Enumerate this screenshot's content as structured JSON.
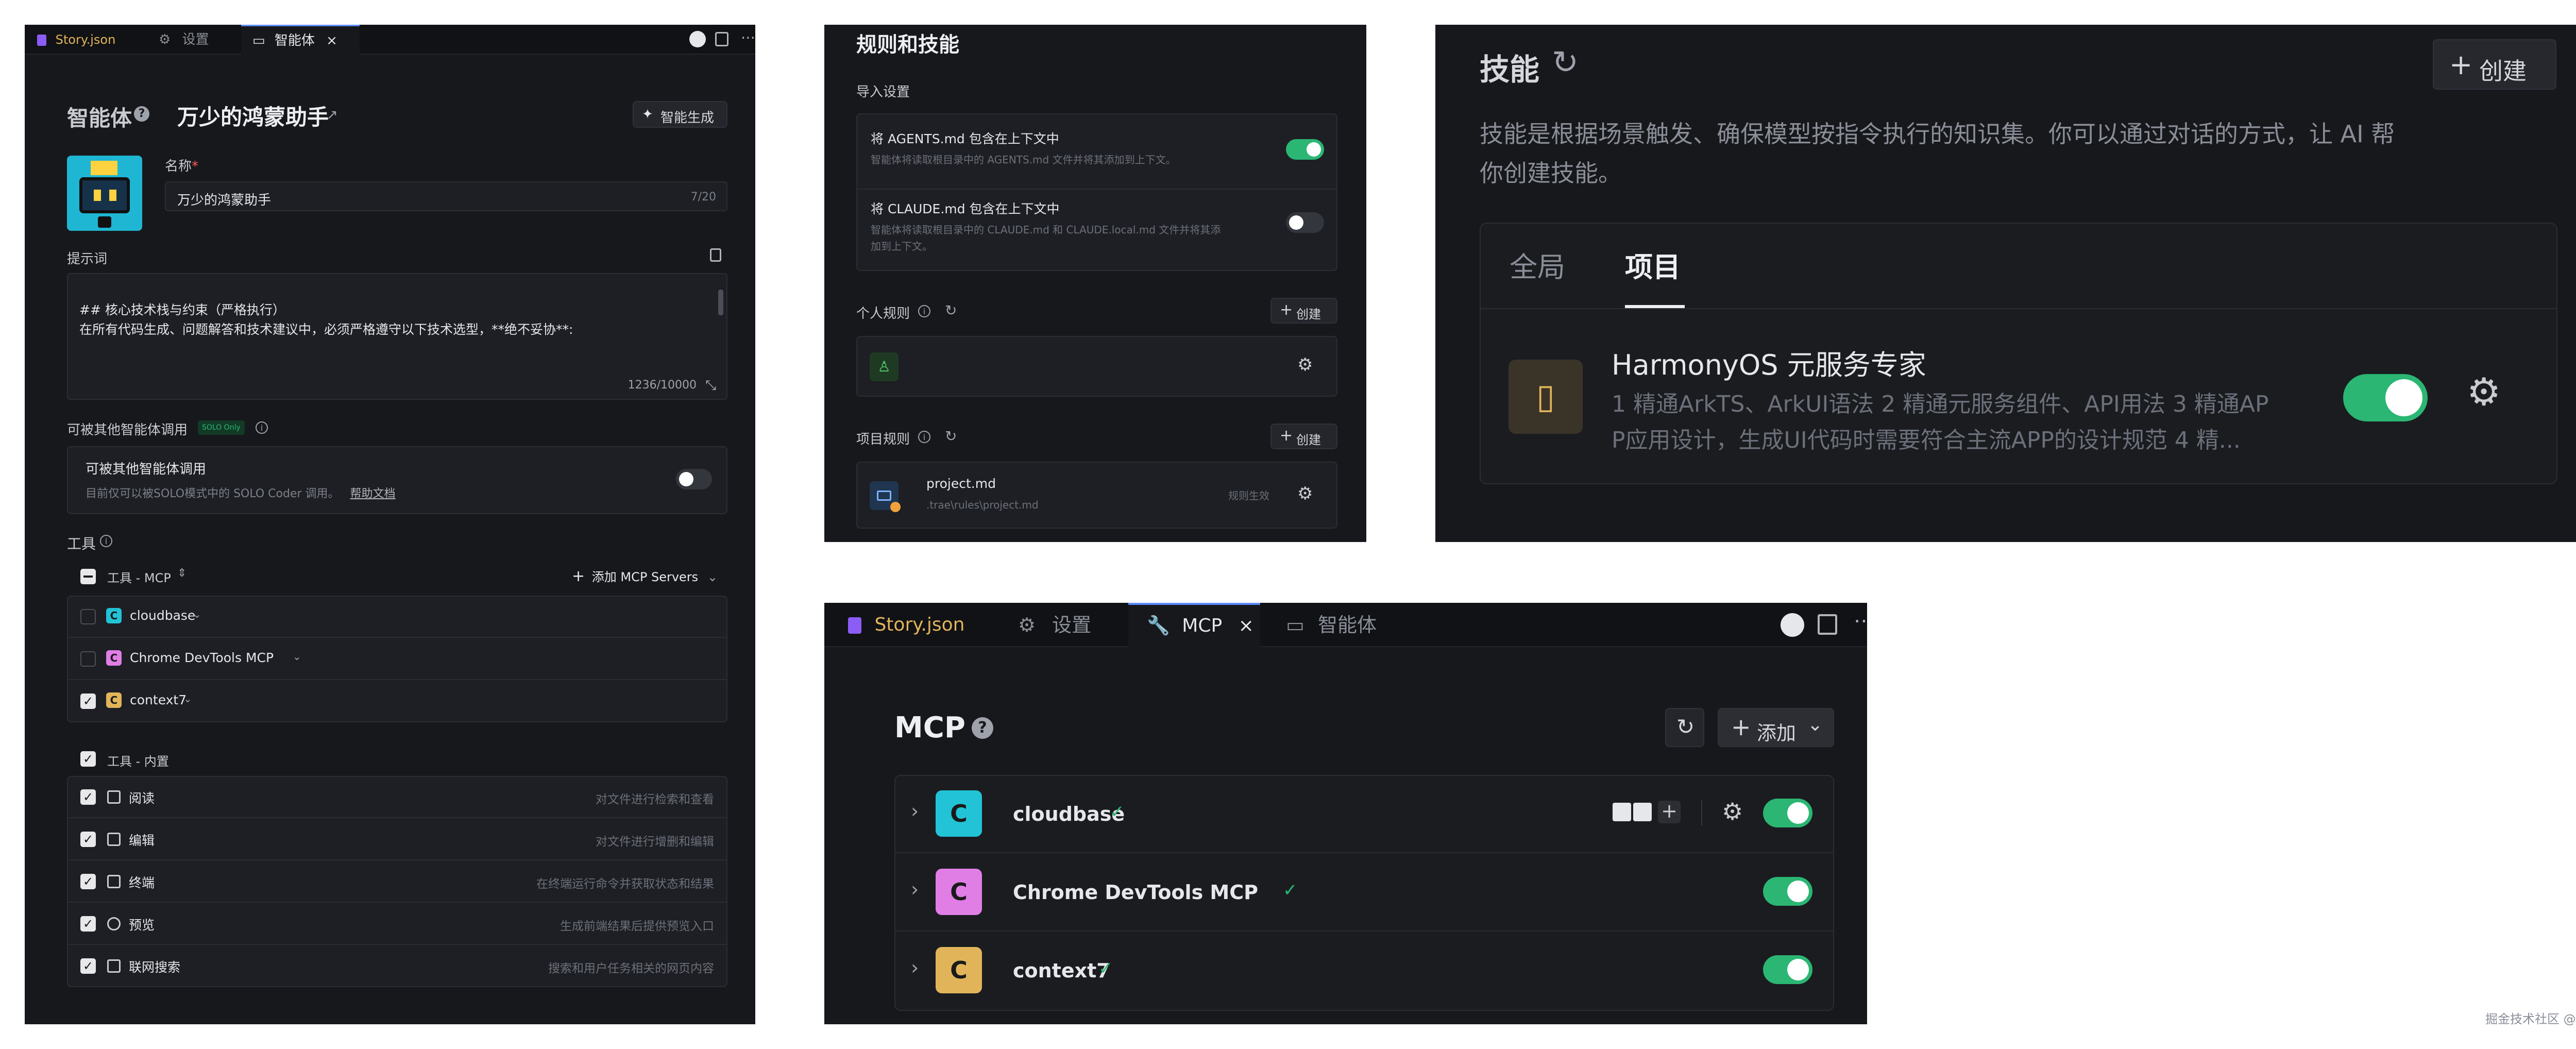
{
  "left": {
    "tabs": [
      {
        "label": "Story.json",
        "close": ""
      },
      {
        "label": "设置",
        "close": ""
      },
      {
        "label": "智能体",
        "close": "×"
      }
    ],
    "header": {
      "section": "智能体",
      "agent_name": "万少的鸿蒙助手",
      "generate_label": "智能生成"
    },
    "name_field": {
      "label": "名称",
      "required": "*",
      "value": "万少的鸿蒙助手",
      "counter": "7/20"
    },
    "prompt": {
      "label": "提示词",
      "line1": "## 核心技术栈与约束（严格执行）",
      "line2": "在所有代码生成、问题解答和技术建议中，必须严格遵守以下技术选型，**绝不妥协**:",
      "counter": "1236/10000"
    },
    "callable": {
      "label": "可被其他智能体调用",
      "badge": "SOLO Only",
      "card_title": "可被其他智能体调用",
      "card_desc": "目前仅可以被SOLO模式中的 SOLO Coder 调用。",
      "doc_link": "帮助文档"
    },
    "tools": {
      "label": "工具",
      "mcp_group": "工具 - MCP",
      "add_mcp": "添加 MCP Servers",
      "mcp_items": [
        {
          "badge": "C",
          "name": "cloudbase",
          "checked": false,
          "color": "#22c3d6"
        },
        {
          "badge": "C",
          "name": "Chrome DevTools MCP",
          "checked": false,
          "color": "#e07ee6"
        },
        {
          "badge": "C",
          "name": "context7",
          "checked": true,
          "color": "#e2b45a"
        }
      ],
      "builtin_group": "工具 - 内置",
      "builtin_items": [
        {
          "name": "阅读",
          "desc": "对文件进行检索和查看"
        },
        {
          "name": "编辑",
          "desc": "对文件进行增删和编辑"
        },
        {
          "name": "终端",
          "desc": "在终端运行命令并获取状态和结果"
        },
        {
          "name": "预览",
          "desc": "生成前端结果后提供预览入口"
        },
        {
          "name": "联网搜索",
          "desc": "搜索和用户任务相关的网页内容"
        }
      ]
    }
  },
  "rules": {
    "title": "规则和技能",
    "import_label": "导入设置",
    "agents_title": "将 AGENTS.md 包含在上下文中",
    "agents_desc": "智能体将读取根目录中的 AGENTS.md 文件并将其添加到上下文。",
    "claude_title": "将 CLAUDE.md 包含在上下文中",
    "claude_desc1": "智能体将读取根目录中的 CLAUDE.md 和 CLAUDE.local.md 文件并将其添",
    "claude_desc2": "加到上下文。",
    "personal_label": "个人规则",
    "create_label": "创建",
    "project_label": "项目规则",
    "project_file": "project.md",
    "project_path": ".trae\\rules\\project.md",
    "project_tag": "规则生效"
  },
  "skills": {
    "title": "技能",
    "create_label": "创建",
    "desc1": "技能是根据场景触发、确保模型按指令执行的知识集。你可以通过对话的方式，让 AI 帮",
    "desc2": "你创建技能。",
    "tabs": [
      "全局",
      "项目"
    ],
    "item_title": "HarmonyOS 元服务专家",
    "item_desc1": "1 精通ArkTS、ArkUI语法 2 精通元服务组件、API用法 3 精通AP",
    "item_desc2": "P应用设计，生成UI代码时需要符合主流APP的设计规范 4 精..."
  },
  "mcp_panel": {
    "tabs": [
      {
        "label": "Story.json",
        "close": ""
      },
      {
        "label": "设置",
        "close": ""
      },
      {
        "label": "MCP",
        "close": "×"
      },
      {
        "label": "智能体",
        "close": ""
      }
    ],
    "title": "MCP",
    "add_label": "添加",
    "servers": [
      {
        "badge": "C",
        "name": "cloudbase",
        "color": "#22c3d6"
      },
      {
        "badge": "C",
        "name": "Chrome DevTools MCP",
        "color": "#e07ee6"
      },
      {
        "badge": "C",
        "name": "context7",
        "color": "#e2b45a"
      }
    ]
  },
  "watermark": "掘金技术社区 @ 万少"
}
